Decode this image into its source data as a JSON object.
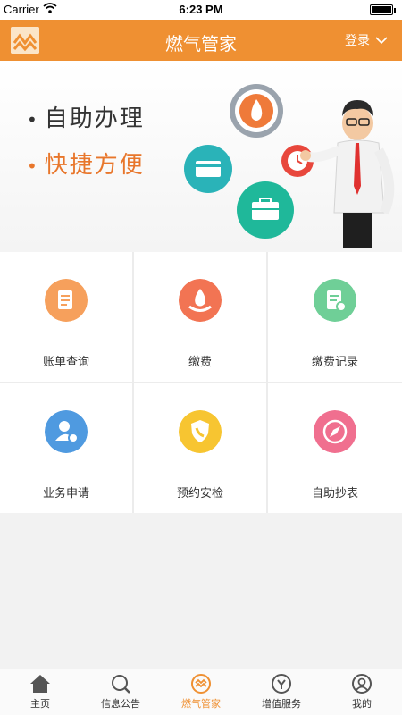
{
  "status_bar": {
    "carrier": "Carrier",
    "time": "6:23 PM"
  },
  "nav": {
    "title": "燃气管家",
    "login_label": "登录"
  },
  "banner": {
    "line1": "自助办理",
    "line2": "快捷方便"
  },
  "services": [
    {
      "label": "账单查询",
      "icon": "bill-icon",
      "color": "#f6a05c"
    },
    {
      "label": "缴费",
      "icon": "flame-payment-icon",
      "color": "#f27453"
    },
    {
      "label": "缴费记录",
      "icon": "record-icon",
      "color": "#6fcf97"
    },
    {
      "label": "业务申请",
      "icon": "user-application-icon",
      "color": "#4f9ae0"
    },
    {
      "label": "预约安检",
      "icon": "shield-phone-icon",
      "color": "#f7c531"
    },
    {
      "label": "自助抄表",
      "icon": "compass-icon",
      "color": "#f06f8f"
    }
  ],
  "tabs": [
    {
      "label": "主页",
      "icon": "home-icon"
    },
    {
      "label": "信息公告",
      "icon": "search-icon"
    },
    {
      "label": "燃气管家",
      "icon": "gas-butler-icon",
      "active": true
    },
    {
      "label": "增值服务",
      "icon": "value-added-icon"
    },
    {
      "label": "我的",
      "icon": "user-icon"
    }
  ],
  "colors": {
    "accent": "#ef9032",
    "banner_highlight": "#e8762b"
  }
}
